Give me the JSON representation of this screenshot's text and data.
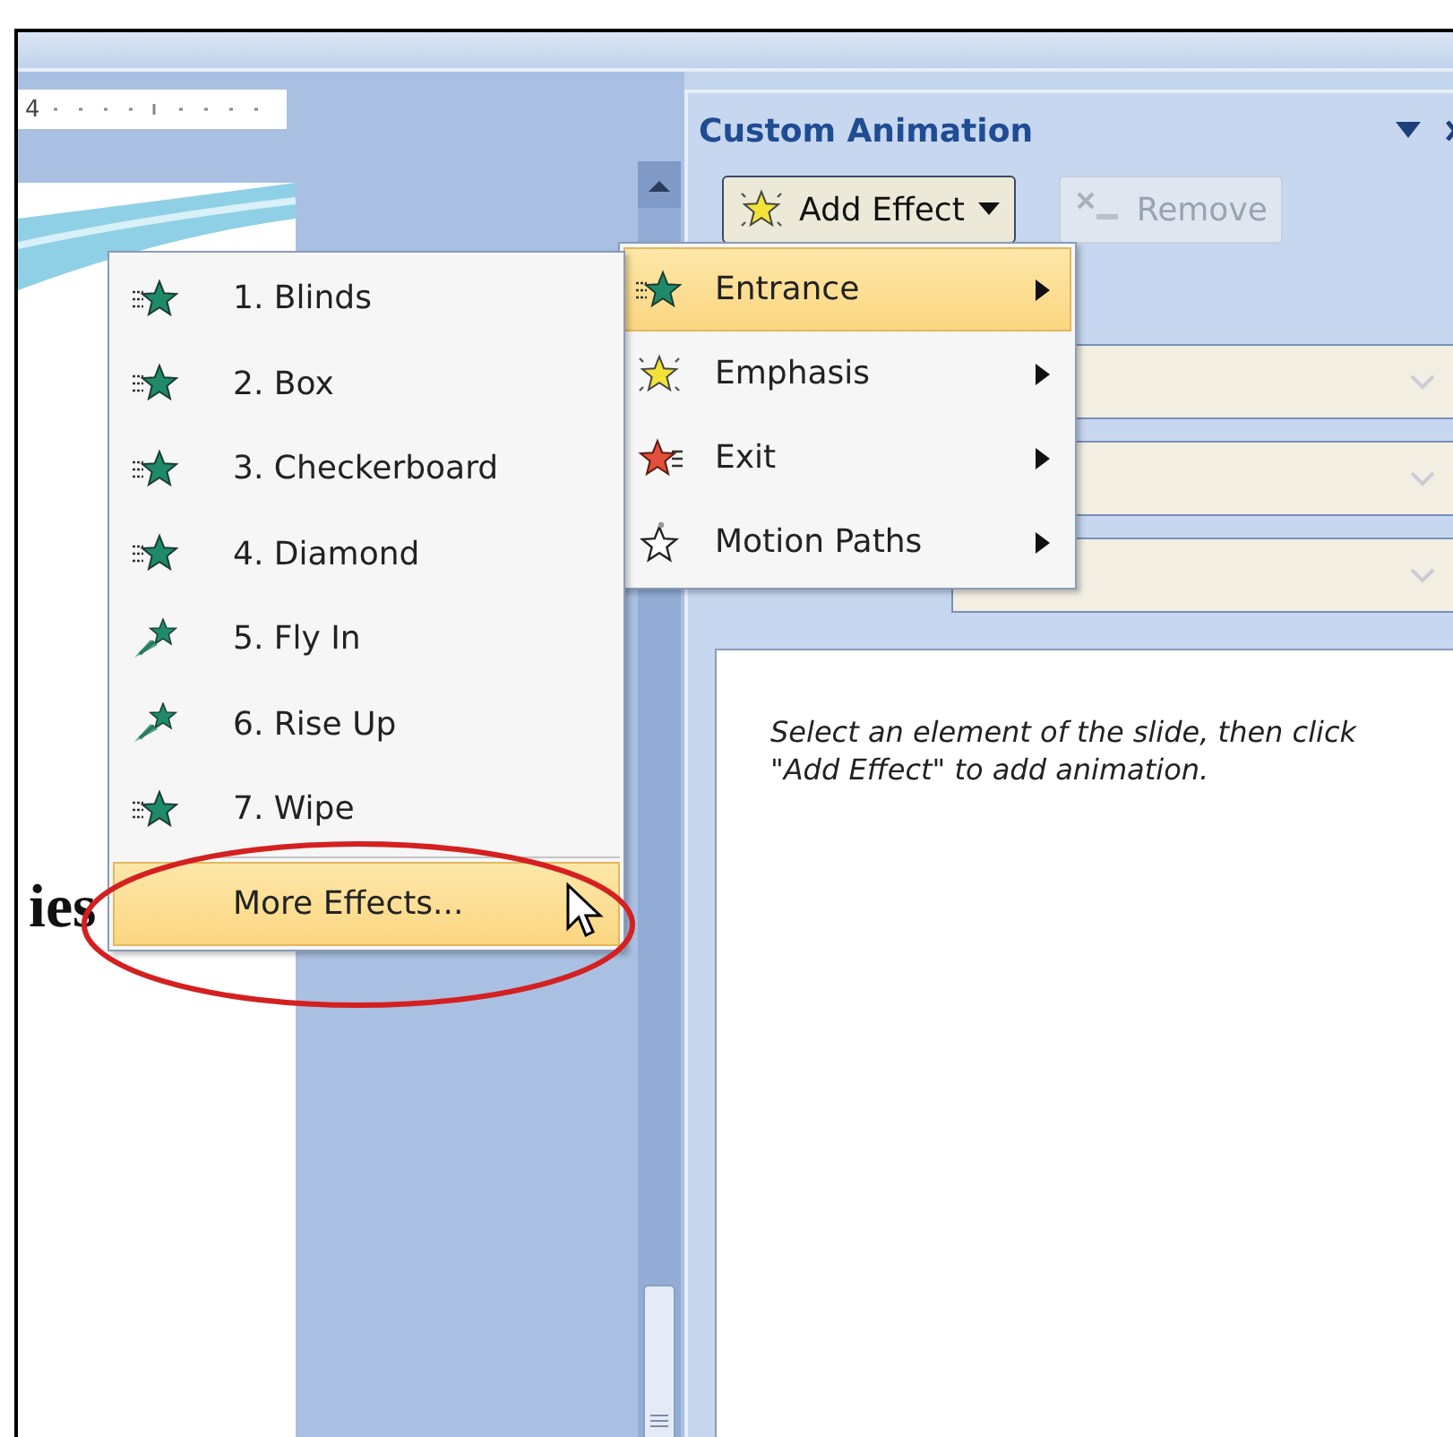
{
  "ruler": {
    "label": "4"
  },
  "slide": {
    "text": "ies"
  },
  "task_pane": {
    "title": "Custom Animation",
    "add_effect_button": {
      "label": "Add Effect",
      "disabled": false
    },
    "remove_button": {
      "label": "Remove",
      "disabled": true
    },
    "fields": [
      {
        "disabled": true
      },
      {
        "disabled": true
      },
      {
        "disabled": true
      }
    ],
    "hint": "Select an element of the slide, then click \"Add Effect\" to add animation."
  },
  "effect_menu": [
    {
      "label": "Entrance",
      "kind": "entrance",
      "selected": true
    },
    {
      "label": "Emphasis",
      "kind": "emphasis",
      "selected": false
    },
    {
      "label": "Exit",
      "kind": "exit",
      "selected": false
    },
    {
      "label": "Motion Paths",
      "kind": "motion",
      "selected": false
    }
  ],
  "entrance_submenu": [
    {
      "label": "1. Blinds",
      "kind": "lines-star",
      "selected": false
    },
    {
      "label": "2. Box",
      "kind": "lines-star",
      "selected": false
    },
    {
      "label": "3. Checkerboard",
      "kind": "lines-star",
      "selected": false
    },
    {
      "label": "4. Diamond",
      "kind": "lines-star",
      "selected": false
    },
    {
      "label": "5. Fly In",
      "kind": "trail-star",
      "selected": false
    },
    {
      "label": "6. Rise Up",
      "kind": "trail-star",
      "selected": false
    },
    {
      "label": "7. Wipe",
      "kind": "lines-star",
      "selected": false
    },
    {
      "label": "More Effects...",
      "kind": "more",
      "selected": true
    }
  ]
}
